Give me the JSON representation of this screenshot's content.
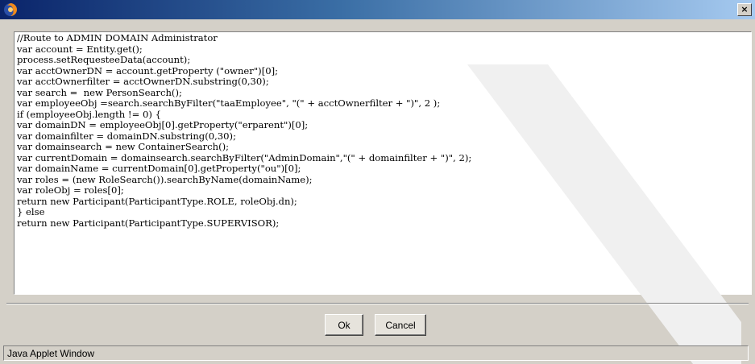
{
  "window": {
    "title_icon": "firefox-icon",
    "close_label": "×"
  },
  "editor": {
    "code": "//Route to ADMIN DOMAIN Administrator\nvar account = Entity.get();\nprocess.setRequesteeData(account);\nvar acctOwnerDN = account.getProperty (\"owner\")[0];\nvar acctOwnerfilter = acctOwnerDN.substring(0,30);\nvar search =  new PersonSearch();\nvar employeeObj =search.searchByFilter(\"taaEmployee\", \"(\" + acctOwnerfilter + \")\", 2 );\nif (employeeObj.length != 0) {\nvar domainDN = employeeObj[0].getProperty(\"erparent\")[0];\nvar domainfilter = domainDN.substring(0,30);\nvar domainsearch = new ContainerSearch();\nvar currentDomain = domainsearch.searchByFilter(\"AdminDomain\",\"(\" + domainfilter + \")\", 2);\nvar domainName = currentDomain[0].getProperty(\"ou\")[0];\nvar roles = (new RoleSearch()).searchByName(domainName);\nvar roleObj = roles[0];\nreturn new Participant(ParticipantType.ROLE, roleObj.dn);\n} else\nreturn new Participant(ParticipantType.SUPERVISOR);"
  },
  "buttons": {
    "ok": "Ok",
    "cancel": "Cancel"
  },
  "status": {
    "text": "Java Applet Window"
  },
  "colors": {
    "title_start": "#0a246a",
    "title_end": "#a6caf0",
    "dialog_bg": "#d4d0c8",
    "watermark": "#f0f0f0"
  }
}
